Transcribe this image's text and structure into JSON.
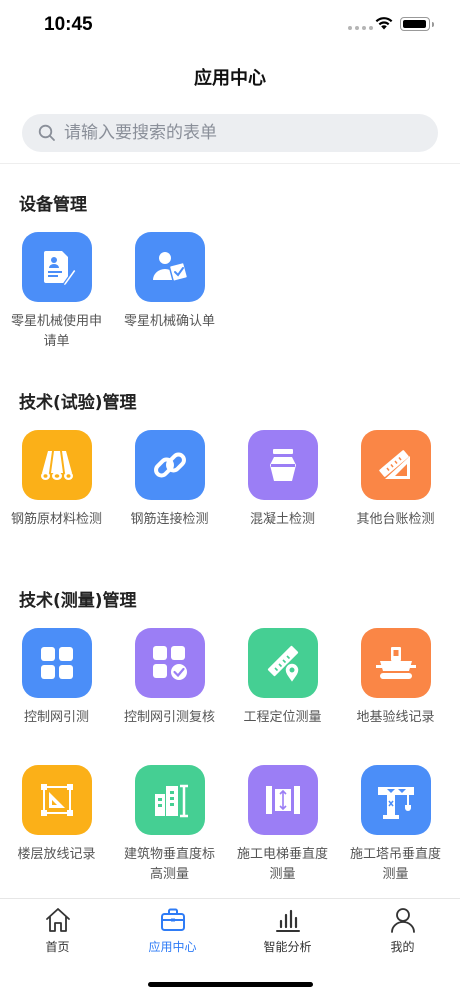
{
  "status": {
    "time": "10:45"
  },
  "header": {
    "title": "应用中心"
  },
  "search": {
    "placeholder": "请输入要搜索的表单"
  },
  "sections": [
    {
      "title": "设备管理"
    },
    {
      "title": "技术(试验)管理"
    },
    {
      "title": "技术(测量)管理"
    }
  ],
  "apps": {
    "equipment": [
      {
        "label": "零星机械使用申请单",
        "color": "#4b8ef8",
        "icon": "document-sign-icon"
      },
      {
        "label": "零星机械确认单",
        "color": "#4b8ef8",
        "icon": "person-confirm-icon"
      }
    ],
    "test": [
      {
        "label": "钢筋原材料检测",
        "color": "#fbb018",
        "icon": "rebar-bundle-icon"
      },
      {
        "label": "钢筋连接检测",
        "color": "#4b8ef8",
        "icon": "link-icon"
      },
      {
        "label": "混凝土检测",
        "color": "#9b7ef5",
        "icon": "concrete-jar-icon"
      },
      {
        "label": "其他台账检测",
        "color": "#fa8646",
        "icon": "ruler-triangle-icon"
      }
    ],
    "survey": [
      {
        "label": "控制网引测",
        "color": "#4b8ef8",
        "icon": "grid-icon"
      },
      {
        "label": "控制网引测复核",
        "color": "#9b7ef5",
        "icon": "grid-check-icon"
      },
      {
        "label": "工程定位测量",
        "color": "#45cf93",
        "icon": "ruler-pin-icon"
      },
      {
        "label": "地基验线记录",
        "color": "#fa8646",
        "icon": "survey-machine-icon"
      },
      {
        "label": "楼层放线记录",
        "color": "#fbb018",
        "icon": "floor-layout-icon"
      },
      {
        "label": "建筑物垂直度标高测量",
        "color": "#45cf93",
        "icon": "building-icon"
      },
      {
        "label": "施工电梯垂直度测量",
        "color": "#9b7ef5",
        "icon": "elevator-icon"
      },
      {
        "label": "施工塔吊垂直度测量",
        "color": "#4b8ef8",
        "icon": "tower-crane-icon"
      }
    ]
  },
  "tabbar": {
    "accent": "#2f7cf6",
    "items": [
      {
        "label": "首页",
        "icon": "home-icon"
      },
      {
        "label": "应用中心",
        "icon": "briefcase-icon"
      },
      {
        "label": "智能分析",
        "icon": "bar-chart-icon"
      },
      {
        "label": "我的",
        "icon": "person-icon"
      }
    ]
  }
}
